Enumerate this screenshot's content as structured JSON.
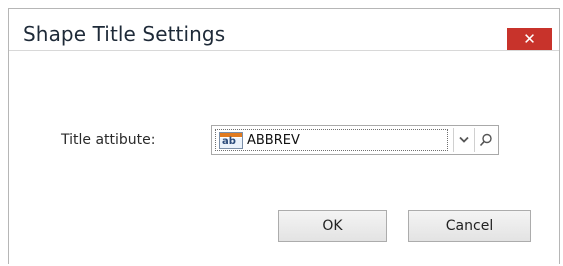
{
  "dialog": {
    "title": "Shape Title Settings",
    "close_label": "✕"
  },
  "form": {
    "title_attribute_label": "Title attibute:",
    "title_attribute_value": "ABBREV",
    "field_type_icon": "ab"
  },
  "buttons": {
    "ok_label": "OK",
    "cancel_label": "Cancel"
  },
  "icons": {
    "dropdown": "chevron-down-icon",
    "search": "search-icon",
    "field_type": "text-field-icon"
  },
  "colors": {
    "close_button": "#c8332b",
    "field_icon_accent": "#e07a1f"
  }
}
